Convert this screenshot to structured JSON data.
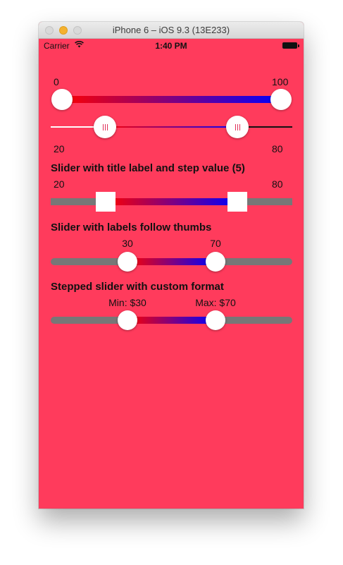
{
  "window": {
    "title": "iPhone 6 – iOS 9.3 (13E233)"
  },
  "status_bar": {
    "carrier": "Carrier",
    "time": "1:40 PM"
  },
  "colors": {
    "background": "#FF3B5C",
    "start": "#FF0000",
    "end": "#0000FF",
    "track": "#777777"
  },
  "sliders": [
    {
      "id": "slider1",
      "min_label": "0",
      "max_label": "100",
      "lower": 0,
      "upper": 100
    },
    {
      "id": "slider2",
      "min_label": "20",
      "max_label": "80",
      "lower": 20,
      "upper": 80
    },
    {
      "id": "slider3",
      "title": "Slider with title label and step value (5)",
      "min_label": "20",
      "max_label": "80",
      "lower": 20,
      "upper": 80
    },
    {
      "id": "slider4",
      "title": "Slider with labels follow thumbs",
      "lower_label": "30",
      "upper_label": "70",
      "lower": 30,
      "upper": 70
    },
    {
      "id": "slider5",
      "title": "Stepped slider with custom format",
      "lower_label": "Min: $30",
      "upper_label": "Max: $70",
      "lower": 30,
      "upper": 70
    }
  ]
}
